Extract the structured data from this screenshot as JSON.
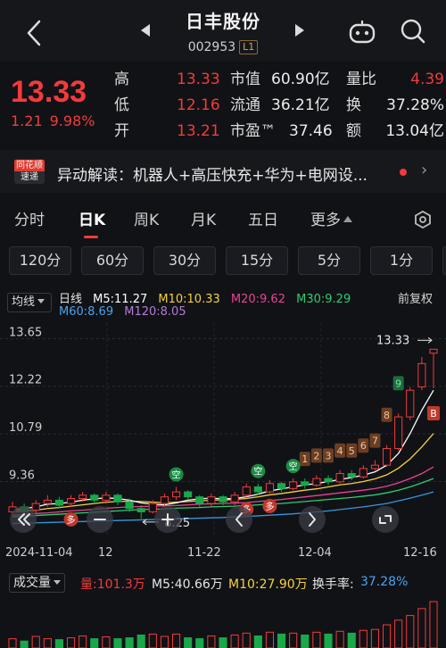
{
  "header": {
    "title": "日丰股份",
    "code": "002953",
    "level_badge": "L1"
  },
  "quote": {
    "price": "13.33",
    "change": "1.21",
    "change_pct": "9.98%",
    "rows": [
      {
        "l1": "高",
        "v1": "13.33",
        "l2": "市值",
        "v2": "60.90亿",
        "l3": "量比",
        "v3": "4.39"
      },
      {
        "l1": "低",
        "v1": "12.16",
        "l2": "流通",
        "v2": "36.21亿",
        "l3": "换",
        "v3": "37.28%"
      },
      {
        "l1": "开",
        "v1": "13.21",
        "l2": "市盈™",
        "v2": "37.46",
        "l3": "额",
        "v3": "13.04亿"
      }
    ]
  },
  "news": {
    "logo_top": "同花顺",
    "logo_bottom": "速递",
    "text": "异动解读：机器人+高压快充+华为+电网设...",
    "close": "›"
  },
  "tabs": {
    "items": [
      "分时",
      "日K",
      "周K",
      "月K",
      "五日",
      "更多"
    ],
    "active": "日K"
  },
  "minute_buttons": [
    "120分",
    "60分",
    "30分",
    "15分",
    "5分",
    "1分"
  ],
  "indicator": {
    "selector": "均线",
    "period": "日线",
    "m5": "M5:11.27",
    "m10": "M10:10.33",
    "m20": "M20:9.62",
    "m30": "M30:9.29",
    "m60": "M60:8.69",
    "m120": "M120:8.05",
    "adjust": "前复权"
  },
  "colors": {
    "up": "#f23b3b",
    "down": "#1aa84b",
    "m5": "#ffffff",
    "m10": "#f4d03f",
    "m20": "#e84393",
    "m30": "#2ecc71",
    "m60": "#3498db",
    "m120": "#9b59b6"
  },
  "chart_data": {
    "type": "candlestick",
    "y_ticks": [
      "13.65",
      "12.22",
      "10.79",
      "9.36"
    ],
    "ylim": [
      7.9,
      13.9
    ],
    "high_label": "13.33",
    "low_label": "8.25",
    "x_labels": [
      "2024-11-04",
      "12",
      "11-22",
      "12-04",
      "12-16"
    ],
    "signals": [
      "1",
      "2",
      "3",
      "4",
      "5",
      "6",
      "7",
      "8",
      "9"
    ],
    "markers_kong": [
      "空",
      "空",
      "空"
    ],
    "markers_duo": [
      "多",
      "多",
      "多"
    ],
    "marker_b": "B",
    "candles": [
      {
        "o": 8.45,
        "c": 8.6,
        "h": 8.75,
        "l": 8.35
      },
      {
        "o": 8.6,
        "c": 8.45,
        "h": 8.7,
        "l": 8.35
      },
      {
        "o": 8.5,
        "c": 8.7,
        "h": 8.8,
        "l": 8.4
      },
      {
        "o": 8.7,
        "c": 8.8,
        "h": 8.95,
        "l": 8.6
      },
      {
        "o": 8.8,
        "c": 8.65,
        "h": 8.9,
        "l": 8.55
      },
      {
        "o": 8.7,
        "c": 8.85,
        "h": 8.95,
        "l": 8.6
      },
      {
        "o": 8.85,
        "c": 8.95,
        "h": 9.05,
        "l": 8.75
      },
      {
        "o": 8.95,
        "c": 8.8,
        "h": 9.0,
        "l": 8.7
      },
      {
        "o": 8.8,
        "c": 8.95,
        "h": 9.05,
        "l": 8.7
      },
      {
        "o": 8.95,
        "c": 8.75,
        "h": 9.0,
        "l": 8.65
      },
      {
        "o": 8.75,
        "c": 8.55,
        "h": 8.85,
        "l": 8.45
      },
      {
        "o": 8.55,
        "c": 8.45,
        "h": 8.65,
        "l": 8.25
      },
      {
        "o": 8.45,
        "c": 8.7,
        "h": 8.8,
        "l": 8.4
      },
      {
        "o": 8.7,
        "c": 8.9,
        "h": 9.0,
        "l": 8.6
      },
      {
        "o": 8.9,
        "c": 9.05,
        "h": 9.2,
        "l": 8.8
      },
      {
        "o": 9.05,
        "c": 8.9,
        "h": 9.1,
        "l": 8.8
      },
      {
        "o": 8.9,
        "c": 8.7,
        "h": 8.95,
        "l": 8.6
      },
      {
        "o": 8.7,
        "c": 8.9,
        "h": 9.0,
        "l": 8.6
      },
      {
        "o": 8.9,
        "c": 8.75,
        "h": 8.95,
        "l": 8.65
      },
      {
        "o": 8.75,
        "c": 8.95,
        "h": 9.05,
        "l": 8.65
      },
      {
        "o": 8.95,
        "c": 9.2,
        "h": 9.3,
        "l": 8.9
      },
      {
        "o": 9.2,
        "c": 9.05,
        "h": 9.3,
        "l": 8.95
      },
      {
        "o": 9.05,
        "c": 9.3,
        "h": 9.4,
        "l": 9.0
      },
      {
        "o": 9.3,
        "c": 9.15,
        "h": 9.35,
        "l": 9.05
      },
      {
        "o": 9.15,
        "c": 9.35,
        "h": 9.45,
        "l": 9.1
      },
      {
        "o": 9.35,
        "c": 9.25,
        "h": 9.45,
        "l": 9.15
      },
      {
        "o": 9.25,
        "c": 9.45,
        "h": 9.55,
        "l": 9.2
      },
      {
        "o": 9.45,
        "c": 9.35,
        "h": 9.55,
        "l": 9.25
      },
      {
        "o": 9.35,
        "c": 9.6,
        "h": 9.7,
        "l": 9.3
      },
      {
        "o": 9.6,
        "c": 9.5,
        "h": 9.7,
        "l": 9.4
      },
      {
        "o": 9.5,
        "c": 9.75,
        "h": 9.85,
        "l": 9.45
      },
      {
        "o": 9.75,
        "c": 9.85,
        "h": 10.0,
        "l": 9.7
      },
      {
        "o": 9.85,
        "c": 10.35,
        "h": 10.45,
        "l": 9.8
      },
      {
        "o": 10.35,
        "c": 11.3,
        "h": 11.4,
        "l": 10.3
      },
      {
        "o": 11.3,
        "c": 12.1,
        "h": 12.2,
        "l": 11.2
      },
      {
        "o": 12.2,
        "c": 12.9,
        "h": 13.1,
        "l": 12.1
      },
      {
        "o": 13.21,
        "c": 13.33,
        "h": 13.33,
        "l": 12.16
      }
    ],
    "ma5": [
      8.5,
      8.55,
      8.6,
      8.68,
      8.7,
      8.74,
      8.8,
      8.84,
      8.87,
      8.85,
      8.8,
      8.72,
      8.68,
      8.66,
      8.72,
      8.8,
      8.84,
      8.86,
      8.84,
      8.85,
      8.9,
      8.98,
      9.08,
      9.14,
      9.2,
      9.26,
      9.3,
      9.36,
      9.42,
      9.48,
      9.55,
      9.65,
      9.85,
      10.2,
      10.8,
      11.5,
      12.1
    ],
    "ma10": [
      8.45,
      8.48,
      8.5,
      8.55,
      8.58,
      8.62,
      8.66,
      8.7,
      8.74,
      8.76,
      8.77,
      8.76,
      8.74,
      8.72,
      8.74,
      8.76,
      8.78,
      8.8,
      8.81,
      8.82,
      8.85,
      8.9,
      8.96,
      9.0,
      9.05,
      9.1,
      9.14,
      9.2,
      9.26,
      9.3,
      9.36,
      9.44,
      9.56,
      9.76,
      10.04,
      10.4,
      10.8
    ],
    "ma20": [
      8.35,
      8.37,
      8.4,
      8.42,
      8.45,
      8.48,
      8.5,
      8.53,
      8.56,
      8.58,
      8.6,
      8.61,
      8.62,
      8.63,
      8.64,
      8.66,
      8.68,
      8.69,
      8.7,
      8.71,
      8.73,
      8.76,
      8.79,
      8.82,
      8.86,
      8.9,
      8.94,
      8.98,
      9.02,
      9.06,
      9.1,
      9.15,
      9.22,
      9.32,
      9.45,
      9.6,
      9.8
    ],
    "ma30": [
      8.3,
      8.32,
      8.34,
      8.36,
      8.38,
      8.4,
      8.42,
      8.44,
      8.46,
      8.48,
      8.5,
      8.52,
      8.53,
      8.54,
      8.56,
      8.57,
      8.58,
      8.6,
      8.61,
      8.62,
      8.64,
      8.66,
      8.68,
      8.7,
      8.73,
      8.76,
      8.79,
      8.82,
      8.85,
      8.88,
      8.92,
      8.96,
      9.02,
      9.1,
      9.2,
      9.32,
      9.45
    ],
    "ma60": [
      8.1,
      8.11,
      8.12,
      8.13,
      8.14,
      8.15,
      8.16,
      8.17,
      8.18,
      8.19,
      8.2,
      8.21,
      8.22,
      8.23,
      8.24,
      8.25,
      8.26,
      8.27,
      8.28,
      8.3,
      8.31,
      8.33,
      8.35,
      8.37,
      8.39,
      8.42,
      8.45,
      8.48,
      8.52,
      8.56,
      8.6,
      8.65,
      8.7,
      8.78,
      8.86,
      8.95,
      9.05
    ],
    "volume": [
      0.2,
      0.15,
      0.25,
      0.2,
      0.18,
      0.22,
      0.26,
      0.2,
      0.24,
      0.2,
      0.22,
      0.28,
      0.3,
      0.25,
      0.3,
      0.22,
      0.2,
      0.26,
      0.22,
      0.28,
      0.32,
      0.26,
      0.34,
      0.3,
      0.32,
      0.28,
      0.34,
      0.3,
      0.36,
      0.32,
      0.38,
      0.4,
      0.5,
      0.6,
      0.7,
      0.85,
      1.0
    ]
  },
  "volume_header": {
    "selector": "成交量",
    "vol": "量:101.3万",
    "m5": "M5:40.66万",
    "m10": "M10:27.90万",
    "turnover_label": "换手率:",
    "turnover": "37.28%"
  }
}
